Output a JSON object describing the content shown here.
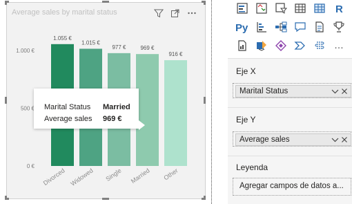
{
  "visual": {
    "title": "Average sales by marital status",
    "toolbar": [
      {
        "name": "filter-icon",
        "label": "Filter"
      },
      {
        "name": "focus-mode-icon",
        "label": "Focus mode"
      },
      {
        "name": "more-options-icon",
        "label": "More options"
      }
    ]
  },
  "chart_data": {
    "type": "bar",
    "title": "Average sales by marital status",
    "categories": [
      "Divorced",
      "Widowed",
      "Single",
      "Married",
      "Other"
    ],
    "values": [
      1055,
      1015,
      977,
      969,
      916
    ],
    "value_labels": [
      "1.055 €",
      "1.015 €",
      "977 €",
      "969 €",
      "916 €"
    ],
    "y_ticks": [
      0,
      500,
      1000
    ],
    "y_tick_labels": [
      "0 €",
      "500 €",
      "1.000 €"
    ],
    "ylim": [
      0,
      1000
    ],
    "colors": [
      "#218a5e",
      "#4ea383",
      "#7bbda2",
      "#8ecaae",
      "#aee2cd"
    ],
    "grid": false,
    "xlabel": "",
    "ylabel": ""
  },
  "tooltip": {
    "rows": [
      {
        "label": "Marital Status",
        "value": "Married"
      },
      {
        "label": "Average sales",
        "value": "969 €"
      }
    ]
  },
  "viz_icons": [
    "stacked-bar-icon",
    "column-chart-icon",
    "funnel-icon",
    "table-icon",
    "matrix-icon",
    "r-visual-icon",
    "python-visual-icon",
    "key-influencers-icon",
    "decomposition-tree-icon",
    "qa-icon",
    "narrative-icon",
    "goals-icon",
    "paginated-report-icon",
    "power-apps-icon",
    "power-automate-icon",
    "azure-map-icon",
    "arcgis-icon",
    "more-visuals-icon"
  ],
  "viz_icon_glyphs": [
    "R",
    "Py",
    "…"
  ],
  "fields": {
    "x_axis": {
      "label": "Eje X",
      "field": "Marital Status"
    },
    "y_axis": {
      "label": "Eje Y",
      "field": "Average sales"
    },
    "legend": {
      "label": "Leyenda",
      "placeholder": "Agregar campos de datos a..."
    }
  }
}
